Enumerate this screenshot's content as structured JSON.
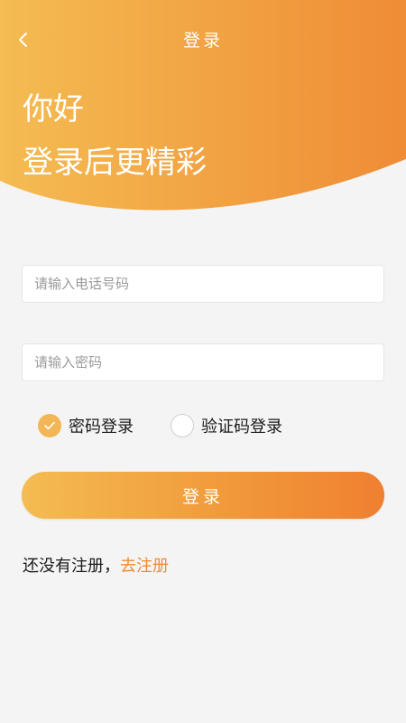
{
  "colors": {
    "header_gradient_start": "#f4bc52",
    "header_gradient_end": "#ef8c36",
    "accent": "#ef8a30",
    "radio_checked": "#f2b656",
    "background": "#f4f4f4"
  },
  "nav": {
    "back_icon": "chevron-left-icon",
    "title": "登录"
  },
  "greeting": {
    "line1": "你好",
    "line2": "登录后更精彩"
  },
  "form": {
    "phone_placeholder": "请输入电话号码",
    "phone_value": "",
    "password_placeholder": "请输入密码",
    "password_value": ""
  },
  "login_mode": {
    "options": [
      {
        "label": "密码登录",
        "checked": true
      },
      {
        "label": "验证码登录",
        "checked": false
      }
    ]
  },
  "login_button": {
    "label": "登录"
  },
  "register": {
    "prompt": "还没有注册，",
    "link": "去注册"
  }
}
